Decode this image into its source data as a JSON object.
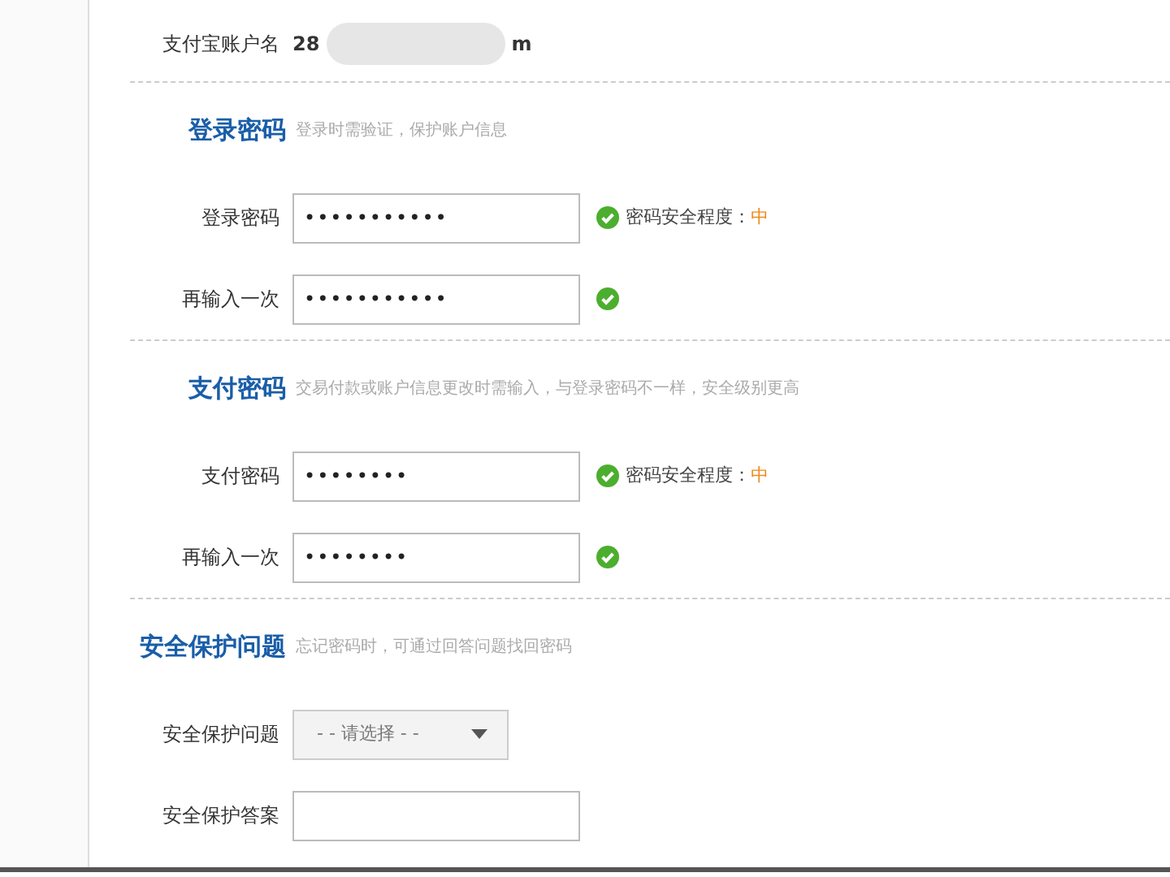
{
  "account": {
    "label": "支付宝账户名",
    "value_start": "28",
    "value_end": "m"
  },
  "sections": [
    {
      "title": "登录密码",
      "description": "登录时需验证，保护账户信息",
      "fields": [
        {
          "kind": "password",
          "label": "登录密码",
          "value": "•••••••••••",
          "valid": true,
          "strength_label": "密码安全程度：",
          "strength": "中"
        },
        {
          "kind": "password",
          "label": "再输入一次",
          "value": "•••••••••••",
          "valid": true
        }
      ]
    },
    {
      "title": "支付密码",
      "description": "交易付款或账户信息更改时需输入，与登录密码不一样，安全级别更高",
      "fields": [
        {
          "kind": "password",
          "label": "支付密码",
          "value": "••••••••",
          "valid": true,
          "strength_label": "密码安全程度：",
          "strength": "中"
        },
        {
          "kind": "password",
          "label": "再输入一次",
          "value": "••••••••",
          "valid": true
        }
      ]
    },
    {
      "title": "安全保护问题",
      "description": "忘记密码时，可通过回答问题找回密码",
      "fields": [
        {
          "kind": "select",
          "label": "安全保护问题",
          "placeholder": "- - 请选择 - -"
        },
        {
          "kind": "text",
          "label": "安全保护答案"
        }
      ]
    }
  ]
}
